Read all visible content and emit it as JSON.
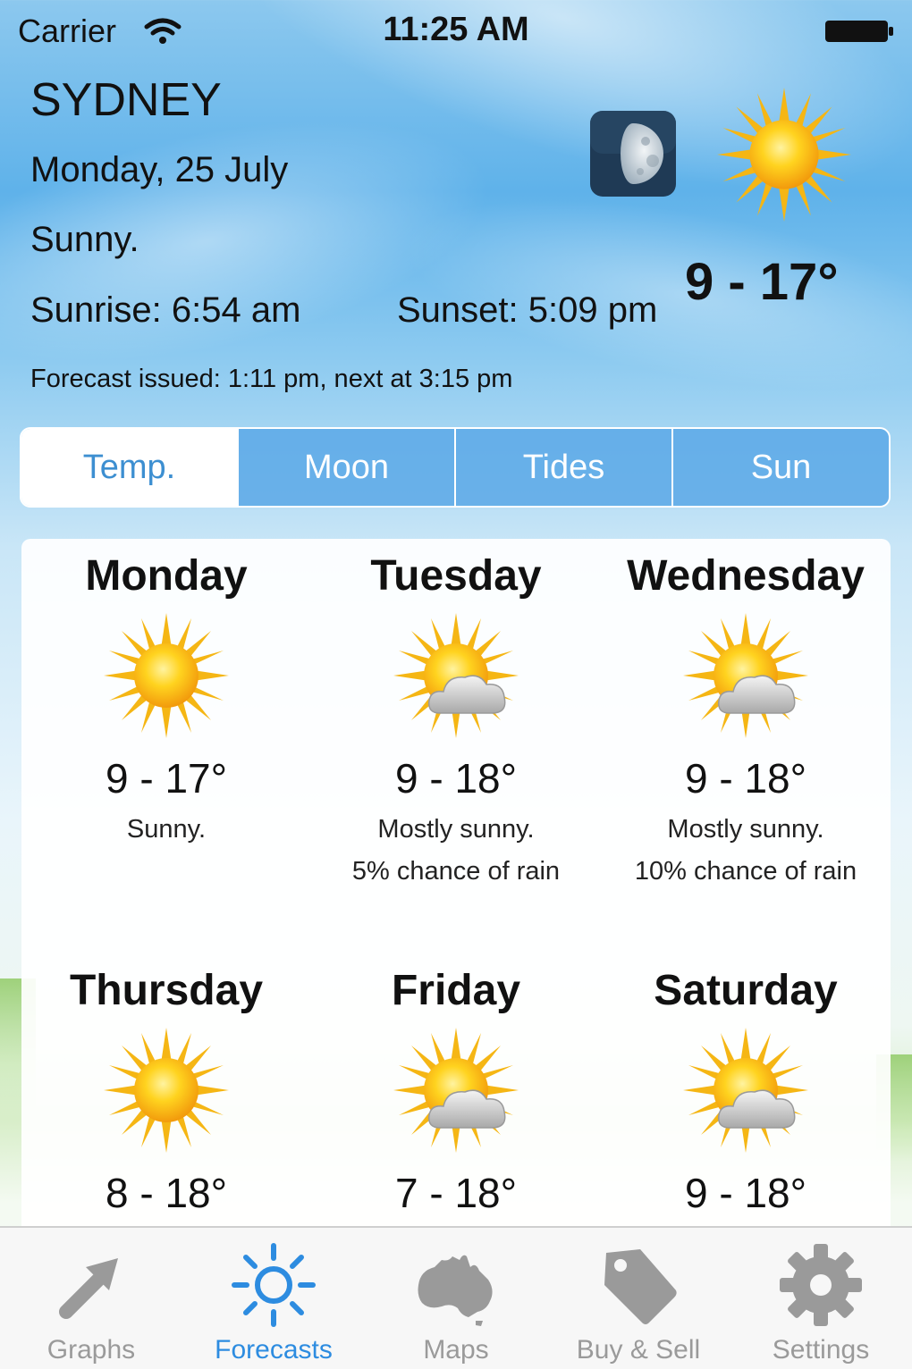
{
  "status_bar": {
    "carrier": "Carrier",
    "time": "11:25 AM"
  },
  "header": {
    "city": "SYDNEY",
    "date": "Monday, 25 July",
    "condition": "Sunny.",
    "sunrise": "Sunrise: 6:54 am",
    "sunset": "Sunset: 5:09 pm",
    "temp_range": "9 - 17°",
    "forecast_issued": "Forecast issued: 1:11 pm, next at 3:15 pm",
    "moon_icon": "moon-phase-icon",
    "weather_icon": "sun-icon"
  },
  "segments": [
    {
      "label": "Temp.",
      "selected": true
    },
    {
      "label": "Moon",
      "selected": false
    },
    {
      "label": "Tides",
      "selected": false
    },
    {
      "label": "Sun",
      "selected": false
    }
  ],
  "forecast": [
    {
      "day": "Monday",
      "icon": "sun-icon",
      "range": "9 - 17°",
      "desc": "Sunny.",
      "rain": ""
    },
    {
      "day": "Tuesday",
      "icon": "sun-cloud-icon",
      "range": "9 - 18°",
      "desc": "Mostly sunny.",
      "rain": "5% chance of rain"
    },
    {
      "day": "Wednesday",
      "icon": "sun-cloud-icon",
      "range": "9 - 18°",
      "desc": "Mostly sunny.",
      "rain": "10% chance of rain"
    },
    {
      "day": "Thursday",
      "icon": "sun-icon",
      "range": "8 - 18°",
      "desc": "",
      "rain": ""
    },
    {
      "day": "Friday",
      "icon": "sun-cloud-icon",
      "range": "7 - 18°",
      "desc": "",
      "rain": ""
    },
    {
      "day": "Saturday",
      "icon": "sun-cloud-icon",
      "range": "9 - 18°",
      "desc": "",
      "rain": ""
    }
  ],
  "tab_bar": [
    {
      "label": "Graphs",
      "icon": "arrow-icon",
      "active": false
    },
    {
      "label": "Forecasts",
      "icon": "sun-outline-icon",
      "active": true
    },
    {
      "label": "Maps",
      "icon": "australia-map-icon",
      "active": false
    },
    {
      "label": "Buy & Sell",
      "icon": "tag-icon",
      "active": false
    },
    {
      "label": "Settings",
      "icon": "gear-icon",
      "active": false
    }
  ],
  "colors": {
    "accent": "#2d8ce0",
    "segment_fill": "#5aa8e6",
    "tab_inactive": "#9a9a9a",
    "sun_yellow": "#f7c21b"
  }
}
